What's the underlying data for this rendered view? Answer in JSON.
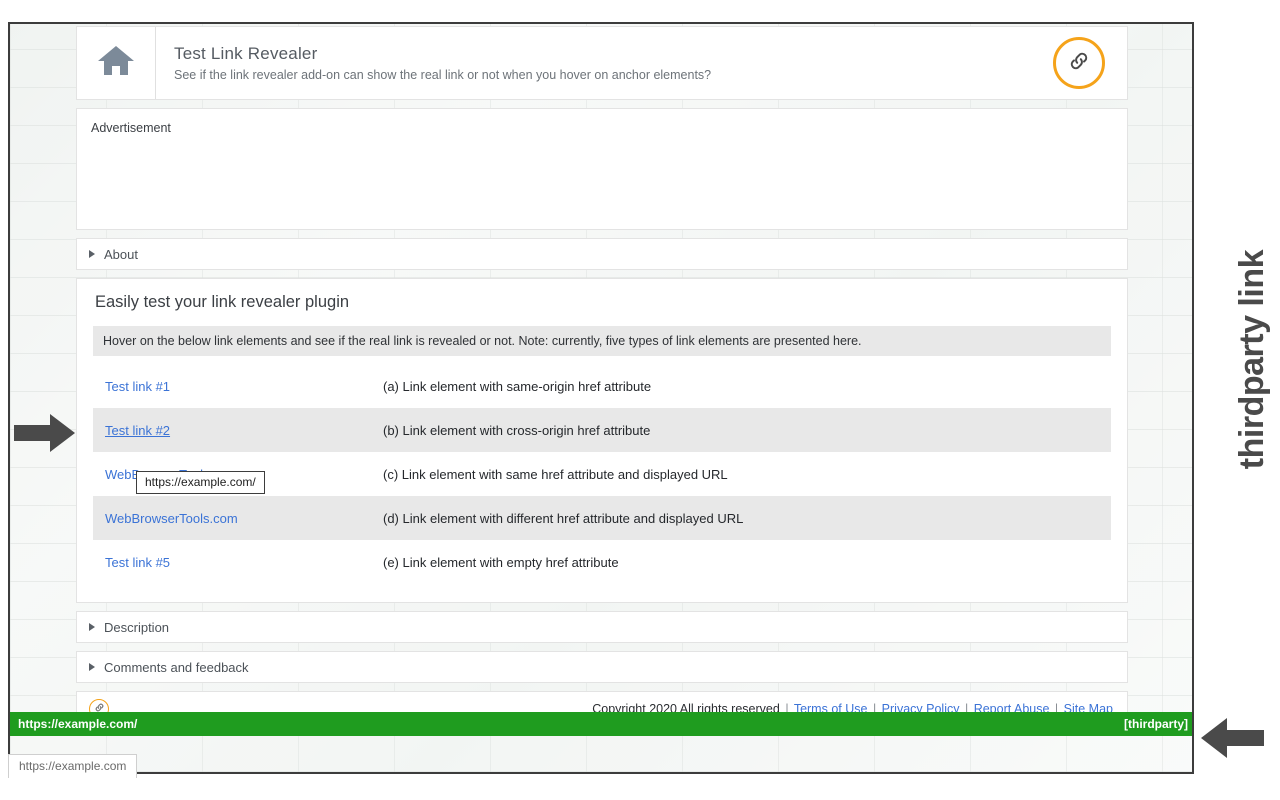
{
  "browser": {
    "status_bar_url": "https://example.com"
  },
  "header": {
    "home_icon": "home-icon",
    "title": "Test Link Revealer",
    "subtitle": "See if the link revealer add-on can show the real link or not when you hover on anchor elements?",
    "badge_icon": "link-chain-icon"
  },
  "advertisement": {
    "label": "Advertisement"
  },
  "accordions": {
    "about": "About",
    "description": "Description",
    "comments": "Comments and feedback"
  },
  "main": {
    "heading": "Easily test your link revealer plugin",
    "notice": "Hover on the below link elements and see if the real link is revealed or not. Note: currently, five types of link elements are presented here.",
    "rows": [
      {
        "link": "Test link #1",
        "desc": "(a) Link element with same-origin href attribute",
        "hovered": false
      },
      {
        "link": "Test link #2",
        "desc": "(b) Link element with cross-origin href attribute",
        "hovered": true
      },
      {
        "link": "WebBrowserTools.com",
        "desc": "(c) Link element with same href attribute and displayed URL",
        "hovered": false
      },
      {
        "link": "WebBrowserTools.com",
        "desc": "(d) Link element with different href attribute and displayed URL",
        "hovered": false
      },
      {
        "link": "Test link #5",
        "desc": "(e) Link element with empty href attribute",
        "hovered": false
      }
    ],
    "tooltip": "https://example.com/"
  },
  "footer": {
    "badge_icon": "link-chain-icon",
    "copyright": "Copyright 2020 All rights reserved",
    "links": [
      "Terms of Use",
      "Privacy Policy",
      "Report Abuse",
      "Site Map"
    ],
    "separator": "|"
  },
  "reveal_bar": {
    "url": "https://example.com/",
    "tag": "[thirdparty]",
    "color": "#1f9c1f"
  },
  "annotations": {
    "side_label": "thirdparty link",
    "left_arrow_icon": "arrow-right-icon",
    "right_arrow_icon": "arrow-left-icon"
  }
}
